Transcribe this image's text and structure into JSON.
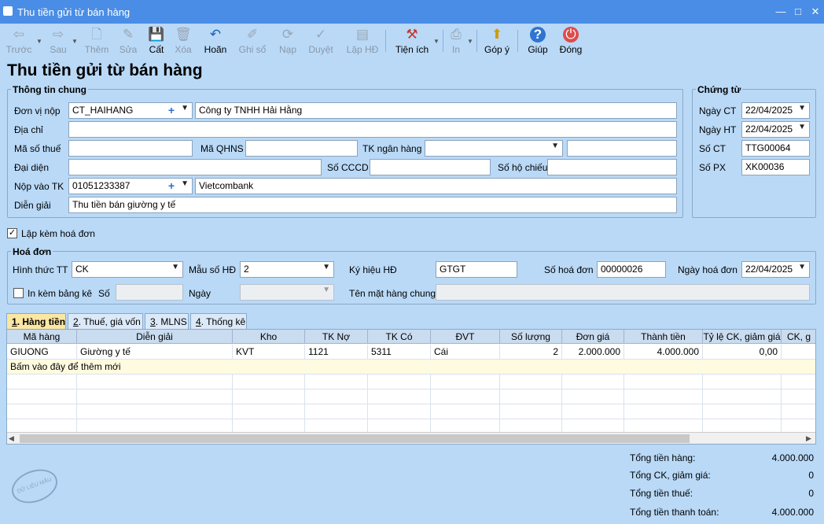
{
  "window": {
    "title": "Thu tiền gửi từ bán hàng",
    "controls": [
      "—",
      "□",
      "✕"
    ]
  },
  "toolbar": [
    {
      "name": "back-button",
      "label": "Trước",
      "icon": "⇦",
      "enabled": false,
      "caret": true
    },
    {
      "name": "next-button",
      "label": "Sau",
      "icon": "⇨",
      "enabled": false,
      "caret": true
    },
    {
      "name": "add-button",
      "label": "Thêm",
      "icon": "🗋",
      "enabled": false
    },
    {
      "name": "edit-button",
      "label": "Sửa",
      "icon": "✎",
      "enabled": false
    },
    {
      "name": "save-button",
      "label": "Cất",
      "icon": "💾",
      "enabled": true
    },
    {
      "name": "delete-button",
      "label": "Xóa",
      "icon": "🗑",
      "enabled": false
    },
    {
      "name": "undo-button",
      "label": "Hoãn",
      "icon": "↶",
      "enabled": true
    },
    {
      "name": "post-button",
      "label": "Ghi sổ",
      "icon": "✐",
      "enabled": false
    },
    {
      "name": "reload-button",
      "label": "Nạp",
      "icon": "⟳",
      "enabled": false
    },
    {
      "name": "approve-button",
      "label": "Duyệt",
      "icon": "✓",
      "enabled": false
    },
    {
      "name": "invoice-button",
      "label": "Lập HĐ",
      "icon": "▤",
      "enabled": false
    },
    {
      "name": "utilities-button",
      "label": "Tiện ích",
      "icon": "⚒",
      "enabled": true,
      "caret": true
    },
    {
      "name": "print-button",
      "label": "In",
      "icon": "⎙",
      "enabled": false,
      "caret": true
    },
    {
      "name": "feedback-button",
      "label": "Góp ý",
      "icon": "⬆",
      "enabled": true
    },
    {
      "name": "help-button",
      "label": "Giúp",
      "icon": "?",
      "enabled": true
    },
    {
      "name": "close-button",
      "label": "Đóng",
      "icon": "⏻",
      "enabled": true
    }
  ],
  "heading": "Thu tiền gửi từ bán hàng",
  "general": {
    "title": "Thông tin chung",
    "payer_label": "Đơn vị nộp",
    "payer_code": "CT_HAIHANG",
    "payer_name": "Công ty TNHH Hải Hằng",
    "address_label": "Địa chỉ",
    "address": "",
    "tax_label": "Mã số thuế",
    "tax": "",
    "qhns_label": "Mã QHNS",
    "qhns": "",
    "bank_label": "TK ngân hàng",
    "bank": "",
    "bank_extra": "",
    "rep_label": "Đại diện",
    "rep": "",
    "cccd_label": "Số CCCD",
    "cccd": "",
    "passport_label": "Số hộ chiếu",
    "passport": "",
    "account_label": "Nộp vào TK",
    "account": "01051233387",
    "account_bank": "Vietcombank",
    "desc_label": "Diễn giải",
    "desc": "Thu tiền bán giường y tế"
  },
  "voucher": {
    "title": "Chứng từ",
    "ngay_ct_label": "Ngày CT",
    "ngay_ct": "22/04/2025",
    "ngay_ht_label": "Ngày HT",
    "ngay_ht": "22/04/2025",
    "so_ct_label": "Số CT",
    "so_ct": "TTG00064",
    "so_px_label": "Số PX",
    "so_px": "XK00036"
  },
  "attach_invoice": {
    "label": "Lập kèm hoá đơn",
    "checked": "✓"
  },
  "invoice": {
    "title": "Hoá đơn",
    "payment_label": "Hình thức TT",
    "payment": "CK",
    "template_label": "Mẫu số HĐ",
    "template": "2",
    "symbol_label": "Ký hiệu HĐ",
    "symbol": "GTGT",
    "number_label": "Số hoá đơn",
    "number": "00000026",
    "date_label": "Ngày hoá đơn",
    "date": "22/04/2025",
    "list_label": "In kèm bảng kê",
    "list_checked": "",
    "so_label": "Số",
    "so": "",
    "ngay_label": "Ngày",
    "ngay": "",
    "common_label": "Tên mặt hàng chung",
    "common": ""
  },
  "tabs": [
    {
      "key": "1",
      "label": ". Hàng tiền",
      "active": true
    },
    {
      "key": "2",
      "label": ". Thuế, giá vốn",
      "active": false
    },
    {
      "key": "3",
      "label": ". MLNS",
      "active": false
    },
    {
      "key": "4",
      "label": ". Thống kê",
      "active": false
    }
  ],
  "grid": {
    "columns": [
      "Mã hàng",
      "Diễn giải",
      "Kho",
      "TK Nợ",
      "TK Có",
      "ĐVT",
      "Số lượng",
      "Đơn giá",
      "Thành tiền",
      "Tỷ lệ CK, giảm giá",
      "CK, g"
    ],
    "rows": [
      [
        "GIUONG",
        "Giường y tế",
        "KVT",
        "1121",
        "5311",
        "Cái",
        "2",
        "2.000.000",
        "4.000.000",
        "0,00",
        ""
      ]
    ],
    "add_row": "Bấm vào đây để thêm mới"
  },
  "totals": [
    {
      "label": "Tổng tiền hàng:",
      "value": "4.000.000"
    },
    {
      "label": "Tổng CK, giảm giá:",
      "value": "0"
    },
    {
      "label": "Tổng tiền thuế:",
      "value": "0"
    },
    {
      "label": "Tổng tiền thanh toán:",
      "value": "4.000.000"
    }
  ],
  "stamp": "DỮ LIỆU MẪU",
  "colors": {
    "titlebar": "#4a8de6",
    "background": "#b9d9f7",
    "active_tab": "#fbe6a2",
    "add_row": "#fffbe0"
  }
}
